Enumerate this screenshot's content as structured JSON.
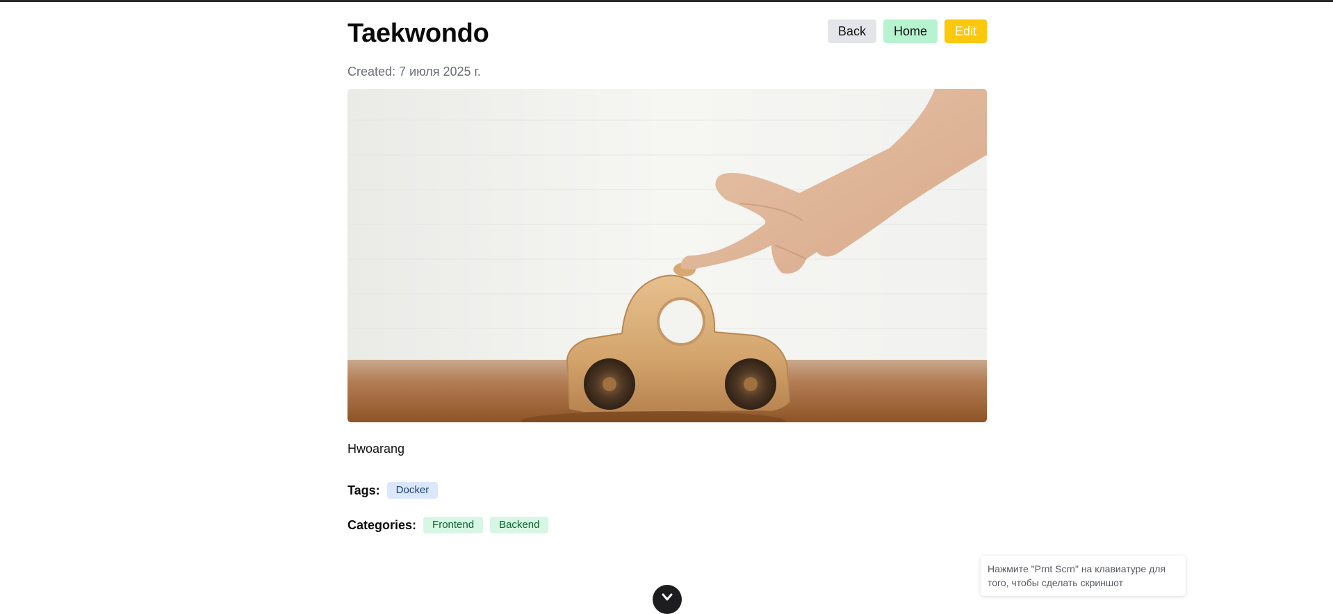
{
  "post": {
    "title": "Taekwondo",
    "created_label": "Created:",
    "created_value": "7 июля 2025 г.",
    "image_alt": "Wooden toy car pushed by a finger",
    "description": "Hwoarang",
    "tags_label": "Tags:",
    "tags": [
      "Docker"
    ],
    "categories_label": "Categories:",
    "categories": [
      "Frontend",
      "Backend"
    ]
  },
  "actions": {
    "back": "Back",
    "home": "Home",
    "edit": "Edit"
  },
  "toast": {
    "text": "Нажмите \"Prnt Scrn\" на клавиатуре для того, чтобы сделать скриншот"
  },
  "colors": {
    "back_button": "#e4e5e8",
    "home_button": "#b7f3cf",
    "edit_button": "#fbc80c",
    "tag_chip": "#dbe7fb",
    "category_chip": "#d5f7e4"
  },
  "icons": {
    "scroll_button": "chevron-down-icon"
  }
}
